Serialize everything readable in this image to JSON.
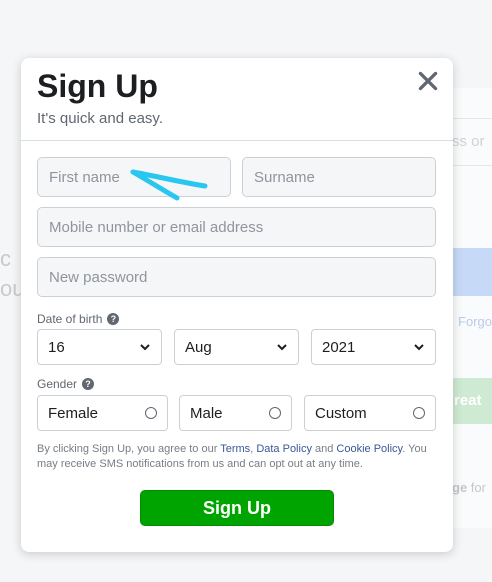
{
  "background": {
    "left_text_1": "c",
    "left_text_2": "ou",
    "input_hint": "ss or",
    "forgot_text": "Forgo",
    "create_text": "reat",
    "page_text_1": "ge",
    "page_text_2": "for"
  },
  "modal": {
    "title": "Sign Up",
    "subtitle": "It's quick and easy.",
    "close_icon": "close-icon"
  },
  "form": {
    "first_name_placeholder": "First name",
    "surname_placeholder": "Surname",
    "mobile_placeholder": "Mobile number or email address",
    "password_placeholder": "New password",
    "dob_label": "Date of birth",
    "dob_day": "16",
    "dob_month": "Aug",
    "dob_year": "2021",
    "gender_label": "Gender",
    "gender_female": "Female",
    "gender_male": "Male",
    "gender_custom": "Custom",
    "help_icon": "?"
  },
  "terms": {
    "text_1": "By clicking Sign Up, you agree to our ",
    "terms_link": "Terms",
    "sep_1": ", ",
    "data_policy_link": "Data Policy",
    "text_2": " and ",
    "cookie_policy_link": "Cookie Policy",
    "text_3": ". You may receive SMS notifications from us and can opt out at any time."
  },
  "signup_button": "Sign Up",
  "colors": {
    "accent_green": "#00a400",
    "link_blue": "#385898",
    "annotation_cyan": "#29c6f0"
  }
}
